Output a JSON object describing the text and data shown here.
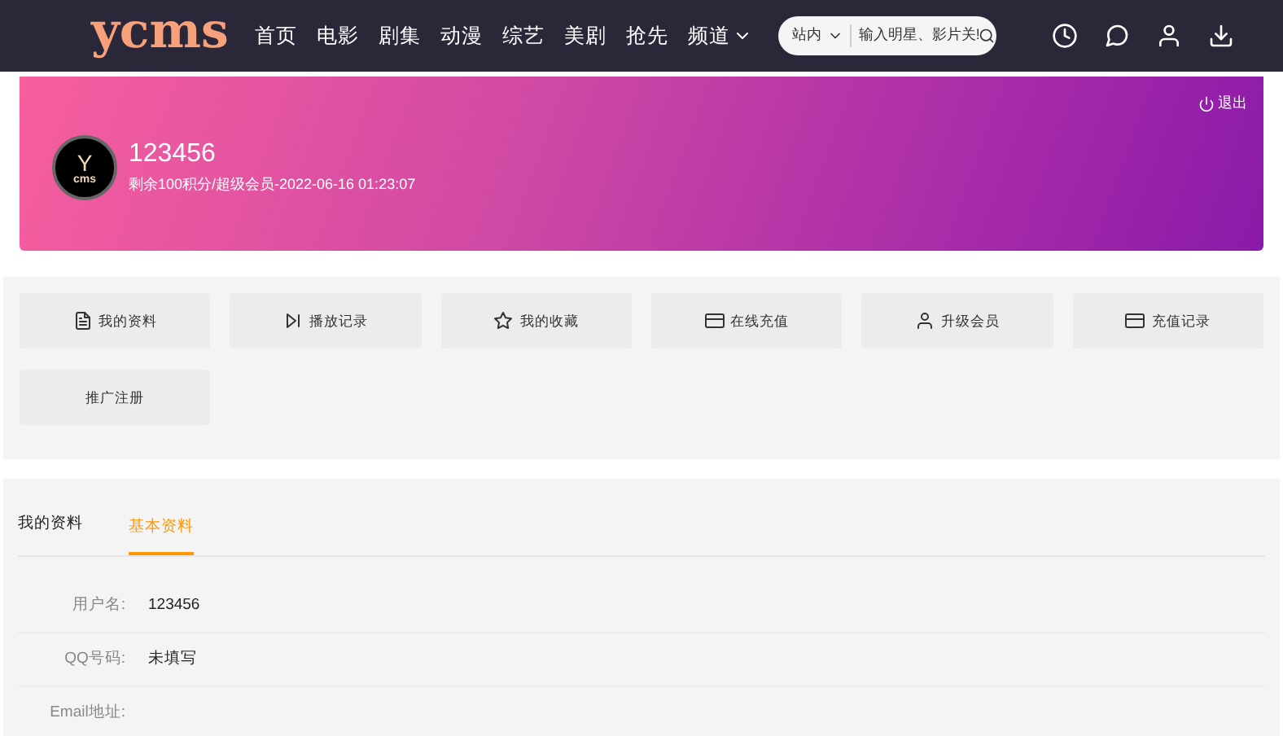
{
  "header": {
    "logo": "ycms",
    "nav": [
      {
        "label": "首页",
        "dropdown": false
      },
      {
        "label": "电影",
        "dropdown": false
      },
      {
        "label": "剧集",
        "dropdown": false
      },
      {
        "label": "动漫",
        "dropdown": false
      },
      {
        "label": "综艺",
        "dropdown": false
      },
      {
        "label": "美剧",
        "dropdown": false
      },
      {
        "label": "抢先",
        "dropdown": false
      },
      {
        "label": "频道",
        "dropdown": true
      }
    ],
    "search": {
      "scope": "站内",
      "placeholder": "输入明星、影片关!"
    }
  },
  "profile": {
    "avatar_text": "cms",
    "avatar_letter": "Y",
    "username": "123456",
    "info": "剩余100积分/超级会员-2022-06-16 01:23:07",
    "logout": "退出"
  },
  "menu": [
    {
      "label": "我的资料",
      "kind": "doc"
    },
    {
      "label": "播放记录",
      "kind": "play"
    },
    {
      "label": "我的收藏",
      "kind": "star"
    },
    {
      "label": "在线充值",
      "kind": "card"
    },
    {
      "label": "升级会员",
      "kind": "user"
    },
    {
      "label": "充值记录",
      "kind": "card"
    },
    {
      "label": "推广注册",
      "kind": "none"
    }
  ],
  "section": {
    "title": "我的资料",
    "tabs": [
      {
        "label": "基本资料",
        "selected": true
      }
    ],
    "fields": [
      {
        "label": "用户名:",
        "value": "123456"
      },
      {
        "label": "QQ号码:",
        "value": "未填写"
      },
      {
        "label": "Email地址:"
      }
    ]
  }
}
